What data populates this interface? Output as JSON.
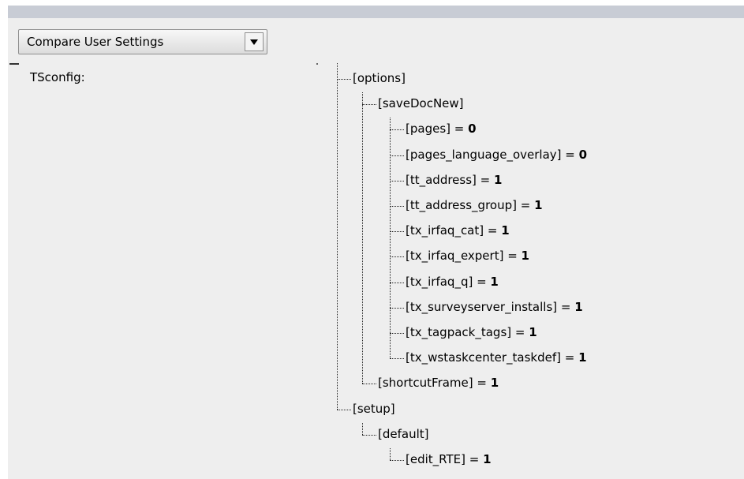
{
  "toolbar": {
    "select_label": "Compare User Settings",
    "dropdown_icon": "chevron-down-icon"
  },
  "row": {
    "label": "TSconfig:"
  },
  "tree": {
    "options": "[options]",
    "saveDocNew": "[saveDocNew]",
    "items": [
      {
        "key": "[pages]",
        "eq": " = ",
        "value": "0"
      },
      {
        "key": "[pages_language_overlay]",
        "eq": " = ",
        "value": "0"
      },
      {
        "key": "[tt_address]",
        "eq": " = ",
        "value": "1"
      },
      {
        "key": "[tt_address_group]",
        "eq": " = ",
        "value": "1"
      },
      {
        "key": "[tx_irfaq_cat]",
        "eq": " = ",
        "value": "1"
      },
      {
        "key": "[tx_irfaq_expert]",
        "eq": " = ",
        "value": "1"
      },
      {
        "key": "[tx_irfaq_q]",
        "eq": " = ",
        "value": "1"
      },
      {
        "key": "[tx_surveyserver_installs]",
        "eq": " = ",
        "value": "1"
      },
      {
        "key": "[tx_tagpack_tags]",
        "eq": " = ",
        "value": "1"
      },
      {
        "key": "[tx_wstaskcenter_taskdef]",
        "eq": " = ",
        "value": "1"
      }
    ],
    "shortcutFrame": {
      "key": "[shortcutFrame]",
      "eq": " = ",
      "value": "1"
    },
    "setup": "[setup]",
    "default": "[default]",
    "edit_RTE": {
      "key": "[edit_RTE]",
      "eq": " = ",
      "value": "1"
    }
  }
}
